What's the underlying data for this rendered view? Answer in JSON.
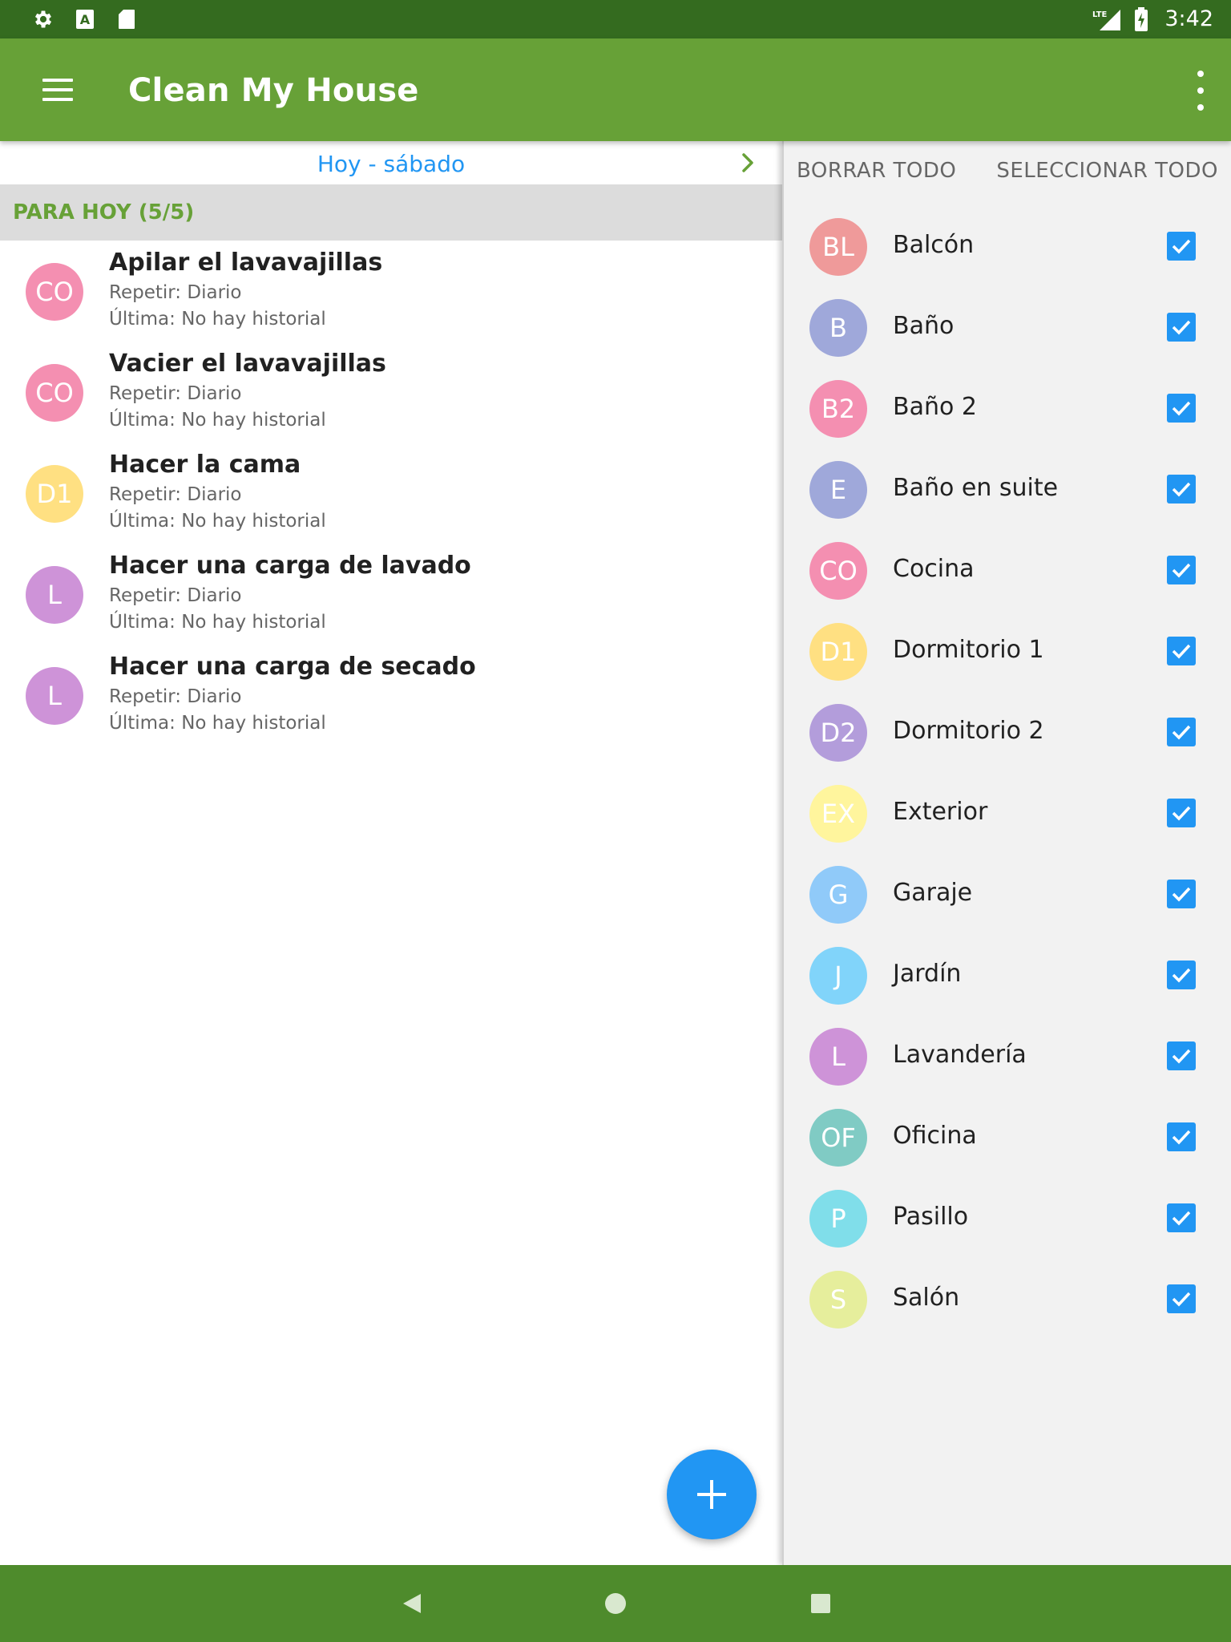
{
  "status_bar": {
    "time": "3:42",
    "network": "LTE"
  },
  "app_bar": {
    "title": "Clean My House"
  },
  "date_nav": {
    "label": "Hoy - sábado"
  },
  "section": {
    "title": "PARA HOY (5/5)"
  },
  "tasks": [
    {
      "avatar": "CO",
      "color": "#f48fb1",
      "name": "Apilar el lavavajillas",
      "repeat": "Repetir: Diario",
      "last": "Última: No hay historial"
    },
    {
      "avatar": "CO",
      "color": "#f48fb1",
      "name": "Vacier el lavavajillas",
      "repeat": "Repetir: Diario",
      "last": "Última: No hay historial"
    },
    {
      "avatar": "D1",
      "color": "#ffe082",
      "name": "Hacer la cama",
      "repeat": "Repetir: Diario",
      "last": "Última: No hay historial"
    },
    {
      "avatar": "L",
      "color": "#ce93d8",
      "name": "Hacer una carga de lavado",
      "repeat": "Repetir: Diario",
      "last": "Última: No hay historial"
    },
    {
      "avatar": "L",
      "color": "#ce93d8",
      "name": "Hacer una carga de secado",
      "repeat": "Repetir: Diario",
      "last": "Última: No hay historial"
    }
  ],
  "filter_panel": {
    "clear_all": "BORRAR TODO",
    "select_all": "SELECCIONAR TODO",
    "rooms": [
      {
        "avatar": "BL",
        "color": "#ef9a9a",
        "name": "Balcón",
        "checked": true
      },
      {
        "avatar": "B",
        "color": "#9fa8da",
        "name": "Baño",
        "checked": true
      },
      {
        "avatar": "B2",
        "color": "#f48fb1",
        "name": "Baño 2",
        "checked": true
      },
      {
        "avatar": "E",
        "color": "#9fa8da",
        "name": "Baño en suite",
        "checked": true
      },
      {
        "avatar": "CO",
        "color": "#f48fb1",
        "name": "Cocina",
        "checked": true
      },
      {
        "avatar": "D1",
        "color": "#ffe082",
        "name": "Dormitorio 1",
        "checked": true
      },
      {
        "avatar": "D2",
        "color": "#b39ddb",
        "name": "Dormitorio 2",
        "checked": true
      },
      {
        "avatar": "EX",
        "color": "#fff59d",
        "name": "Exterior",
        "checked": true
      },
      {
        "avatar": "G",
        "color": "#90caf9",
        "name": "Garaje",
        "checked": true
      },
      {
        "avatar": "J",
        "color": "#81d4fa",
        "name": "Jardín",
        "checked": true
      },
      {
        "avatar": "L",
        "color": "#ce93d8",
        "name": "Lavandería",
        "checked": true
      },
      {
        "avatar": "OF",
        "color": "#80cbc4",
        "name": "Oficina",
        "checked": true
      },
      {
        "avatar": "P",
        "color": "#80deea",
        "name": "Pasillo",
        "checked": true
      },
      {
        "avatar": "S",
        "color": "#e6ee9c",
        "name": "Salón",
        "checked": true
      }
    ]
  },
  "colors": {
    "status_bar": "#346b1f",
    "app_bar": "#67a137",
    "accent": "#2196f3",
    "nav_bar": "#4e8b2c"
  }
}
